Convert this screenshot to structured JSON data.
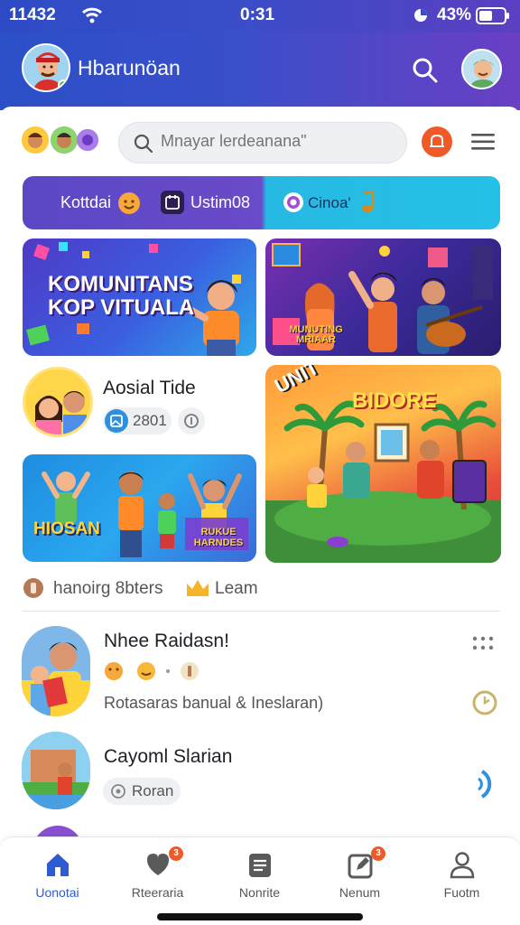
{
  "status_bar": {
    "left_time": "11432",
    "center_time": "0:31",
    "battery": "43%"
  },
  "header": {
    "title": "Hbarunöan"
  },
  "search": {
    "placeholder": "Mnayar lerdeanana\""
  },
  "chips": {
    "first": "Kottdai",
    "second": "Ustim08",
    "third": "Cinoa'"
  },
  "banners": {
    "main_line1": "KOMUNITANS",
    "main_line2": "KOP VITUALA",
    "music_label": "MUNUTING MRIAAR",
    "poster_left": "HIOSAN",
    "poster_right": "RUKUE HARNDES",
    "poster_big_a": "UNIT",
    "poster_big_b": "BIDORE"
  },
  "profile_card": {
    "name": "Aosial Tide",
    "count": "2801"
  },
  "section": {
    "label": "hanoirg 8bters",
    "learn": "Leam"
  },
  "feed": [
    {
      "name": "Nhee Raidasn!",
      "subtitle": "Rotasaras banual & Ineslaran)"
    },
    {
      "name": "Cayoml Slarian",
      "tag": "Roran"
    }
  ],
  "nav": [
    {
      "label": "Uonotai"
    },
    {
      "label": "Rteeraria",
      "badge": "3"
    },
    {
      "label": "Nonrite"
    },
    {
      "label": "Nenum",
      "badge": "3"
    },
    {
      "label": "Fuotm"
    }
  ],
  "colors": {
    "header": "#3a4fca",
    "accent": "#f05a28",
    "nav_active": "#2f5bd0",
    "chip_left": "#5b47c4",
    "chip_right": "#25c0e6"
  }
}
